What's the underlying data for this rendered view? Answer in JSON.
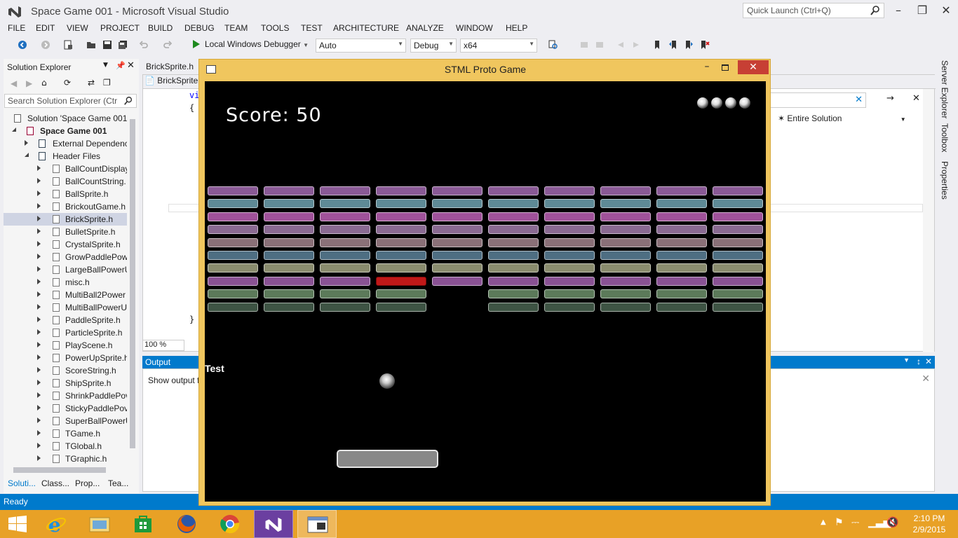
{
  "app": {
    "title": "Space Game 001 - Microsoft Visual Studio",
    "quick_launch_placeholder": "Quick Launch (Ctrl+Q)"
  },
  "menu": [
    "FILE",
    "EDIT",
    "VIEW",
    "PROJECT",
    "BUILD",
    "DEBUG",
    "TEAM",
    "TOOLS",
    "TEST",
    "ARCHITECTURE",
    "ANALYZE",
    "WINDOW",
    "HELP"
  ],
  "toolbar": {
    "debugger_label": "Local Windows Debugger",
    "config_auto": "Auto",
    "config_build": "Debug",
    "platform": "x64"
  },
  "solution_explorer": {
    "title": "Solution Explorer",
    "search_placeholder": "Search Solution Explorer (Ctr",
    "solution": "Solution 'Space Game 001'",
    "project": "Space Game 001",
    "external": "External Dependenc",
    "header_folder": "Header Files",
    "files": [
      "BallCountDisplay",
      "BallCountString.",
      "BallSprite.h",
      "BrickoutGame.h",
      "BrickSprite.h",
      "BulletSprite.h",
      "CrystalSprite.h",
      "GrowPaddlePow",
      "LargeBallPowerU",
      "misc.h",
      "MultiBall2Power",
      "MultiBallPowerU",
      "PaddleSprite.h",
      "ParticleSprite.h",
      "PlayScene.h",
      "PowerUpSprite.h",
      "ScoreString.h",
      "ShipSprite.h",
      "ShrinkPaddlePov",
      "StickyPaddlePov",
      "SuperBallPowerU",
      "TGame.h",
      "TGlobal.h",
      "TGraphic.h"
    ],
    "selected_file": "BrickSprite.h",
    "tabs": [
      "Soluti...",
      "Class...",
      "Prop...",
      "Tea..."
    ]
  },
  "editor": {
    "tab_label": "BrickSprite.h",
    "nav_left": "BrickSprite",
    "scope_label": "Entire Solution",
    "zoom": "100 %",
    "code_lines": [
      "vi",
      "{",
      "}"
    ]
  },
  "output": {
    "title": "Output",
    "show_output_from": "Show output f"
  },
  "side_tabs": [
    "Server Explorer",
    "Toolbox",
    "Properties"
  ],
  "status": {
    "text": "Ready"
  },
  "clock": {
    "time": "2:10 PM",
    "date": "2/9/2015"
  },
  "game": {
    "window_title": "STML Proto Game",
    "score_text": "Score: 50",
    "test_label": "Test",
    "lives": 4,
    "brick_row_colors": [
      "#8a5a96",
      "#5e8a96",
      "#a0529a",
      "#8a6a92",
      "#8a7078",
      "#4e6e82",
      "#8a8c6e",
      "#8a5294",
      "#5c7a5a",
      "#3e5444"
    ],
    "missing_bricks": [
      [
        8,
        4
      ],
      [
        9,
        4
      ]
    ],
    "red_brick": [
      7,
      3
    ],
    "red_brick_color": "#c01818"
  },
  "colors": {
    "accent": "#007acc",
    "taskbar": "#e8a126",
    "game_frame": "#f0c65e"
  }
}
